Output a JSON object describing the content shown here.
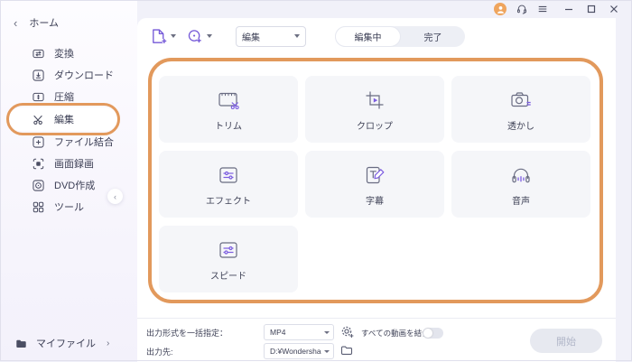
{
  "titlebar": {
    "icons": [
      "avatar",
      "headset-icon",
      "menu-icon",
      "minimize-icon",
      "maximize-icon",
      "close-icon"
    ]
  },
  "sidebar": {
    "back_label": "ホーム",
    "items": [
      {
        "label": "変換",
        "icon": "convert-icon",
        "selected": false
      },
      {
        "label": "ダウンロード",
        "icon": "download-icon",
        "selected": false
      },
      {
        "label": "圧縮",
        "icon": "compress-icon",
        "selected": false
      },
      {
        "label": "編集",
        "icon": "edit-scissors-icon",
        "selected": true,
        "annotated": true
      },
      {
        "label": "ファイル結合",
        "icon": "merge-icon",
        "selected": false
      },
      {
        "label": "画面録画",
        "icon": "screen-record-icon",
        "selected": false
      },
      {
        "label": "DVD作成",
        "icon": "dvd-icon",
        "selected": false
      },
      {
        "label": "ツール",
        "icon": "tools-icon",
        "selected": false
      }
    ],
    "my_files_label": "マイファイル"
  },
  "toolbar": {
    "add_file_icon": "add-file-icon",
    "add_disc_icon": "add-disc-icon",
    "mode_select_value": "編集",
    "tabs": [
      {
        "label": "編集中",
        "active": true
      },
      {
        "label": "完了",
        "active": false
      }
    ]
  },
  "tools": [
    {
      "label": "トリム",
      "icon": "trim-icon"
    },
    {
      "label": "クロップ",
      "icon": "crop-icon"
    },
    {
      "label": "透かし",
      "icon": "watermark-icon"
    },
    {
      "label": "エフェクト",
      "icon": "effect-icon"
    },
    {
      "label": "字幕",
      "icon": "subtitle-icon"
    },
    {
      "label": "音声",
      "icon": "audio-icon"
    },
    {
      "label": "スピード",
      "icon": "speed-icon"
    }
  ],
  "footer": {
    "format_label": "出力形式を一括指定：",
    "format_value": "MP4",
    "settings_icon": "gear-plus-icon",
    "merge_label": "すべての動画を結合",
    "merge_toggle_on": false,
    "output_label": "出力先:",
    "output_value": "D:¥Wondershare UniConverter",
    "folder_icon": "folder-icon",
    "start_label": "開始"
  },
  "colors": {
    "accent_purple": "#7458d8",
    "annotation_orange": "#e2995c",
    "window_bg": "#f1f1f9",
    "panel_bg": "#ffffff",
    "tile_bg": "#f5f6f9",
    "avatar_orange": "#efa55e"
  }
}
